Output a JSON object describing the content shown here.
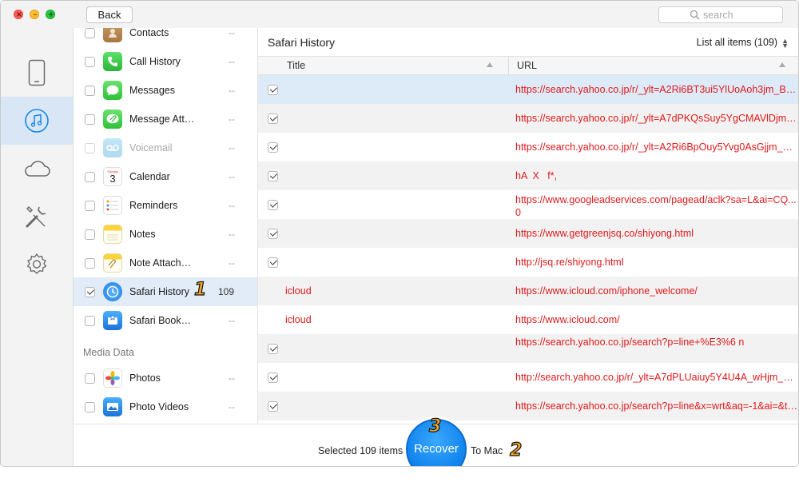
{
  "window": {
    "traffic": {
      "close": "×",
      "minimize": "–",
      "maximize": "+"
    },
    "back_label": "Back",
    "search_placeholder": "search"
  },
  "rail": {
    "items": [
      {
        "icon": "iphone-icon",
        "active": false
      },
      {
        "icon": "itunes-music-icon",
        "active": true
      },
      {
        "icon": "icloud-icon",
        "active": false
      },
      {
        "icon": "tools-icon",
        "active": false
      },
      {
        "icon": "settings-gear-icon",
        "active": false
      }
    ]
  },
  "categories": [
    {
      "label": "Contacts",
      "count": "--",
      "icon": "contacts-icon",
      "checked": false
    },
    {
      "label": "Call History",
      "count": "--",
      "icon": "phone-icon",
      "checked": false
    },
    {
      "label": "Messages",
      "count": "--",
      "icon": "messages-icon",
      "checked": false
    },
    {
      "label": "Message Att…",
      "count": "--",
      "icon": "message-attachment-icon",
      "checked": false
    },
    {
      "label": "Voicemail",
      "count": "--",
      "icon": "voicemail-icon",
      "checked": false,
      "disabled": true
    },
    {
      "label": "Calendar",
      "count": "--",
      "icon": "calendar-icon",
      "checked": false
    },
    {
      "label": "Reminders",
      "count": "--",
      "icon": "reminders-icon",
      "checked": false
    },
    {
      "label": "Notes",
      "count": "--",
      "icon": "notes-icon",
      "checked": false
    },
    {
      "label": "Note Attach…",
      "count": "--",
      "icon": "note-attachment-icon",
      "checked": false
    },
    {
      "label": "Safari History",
      "count": "109",
      "icon": "safari-history-icon",
      "checked": true,
      "selected": true
    },
    {
      "label": "Safari Book…",
      "count": "--",
      "icon": "safari-bookmarks-icon",
      "checked": false
    }
  ],
  "media_section": {
    "heading": "Media Data",
    "items": [
      {
        "label": "Photos",
        "count": "--",
        "icon": "photos-icon",
        "checked": false
      },
      {
        "label": "Photo Videos",
        "count": "--",
        "icon": "photo-videos-icon",
        "checked": false
      }
    ]
  },
  "calendar_icon_day": "3",
  "markers": {
    "one": "1",
    "two": "2",
    "three": "3"
  },
  "main": {
    "title": "Safari History",
    "list_filter": "List all items (109)",
    "columns": {
      "title": "Title",
      "url": "URL"
    },
    "rows": [
      {
        "title": "",
        "url": "https://search.yahoo.co.jp/r/_ylt=A2Ri6BT3ui5YlUoAoh3jm_B7/..."
      },
      {
        "title": "",
        "url": "https://search.yahoo.co.jp/r/_ylt=A7dPKQsSuy5YgCMAVlDjm_..."
      },
      {
        "title": "",
        "url": "https://search.yahoo.co.jp/r/_ylt=A2Ri6BpOuy5Yvg0AsGjjm_B7..."
      },
      {
        "title": "",
        "url": "hA  X   f*,"
      },
      {
        "title": "",
        "url": "https://www.googleadservices.com/pagead/aclk?sa=L&ai=CQ... 0",
        "wrap": true
      },
      {
        "title": "",
        "url": "https://www.getgreenjsq.co/shiyong.html"
      },
      {
        "title": "",
        "url": "http://jsq.re/shiyong.html"
      },
      {
        "title": "icloud",
        "url": "https://www.icloud.com/iphone_welcome/"
      },
      {
        "title": "icloud",
        "url": "https://www.icloud.com/"
      },
      {
        "title": "",
        "url": "https://search.yahoo.co.jp/search?p=line+%E3%6 n",
        "top": true
      },
      {
        "title": "",
        "url": "http://search.yahoo.co.jp/r/_ylt=A7dPLUaiuy5Y4U4A_wHjm_B7..."
      },
      {
        "title": "",
        "url": "https://search.yahoo.co.jp/search?p=line&x=wrt&aq=-1&ai=&ts..."
      }
    ]
  },
  "bottom": {
    "selected_text": "Selected 109 items",
    "recover_label": "Recover",
    "to_mac_label": "To Mac"
  },
  "colors": {
    "accent": "#1487ef",
    "url_red": "#e0191b",
    "selected_row": "#ddeaf7",
    "rail_active": "#d8e6f5"
  }
}
